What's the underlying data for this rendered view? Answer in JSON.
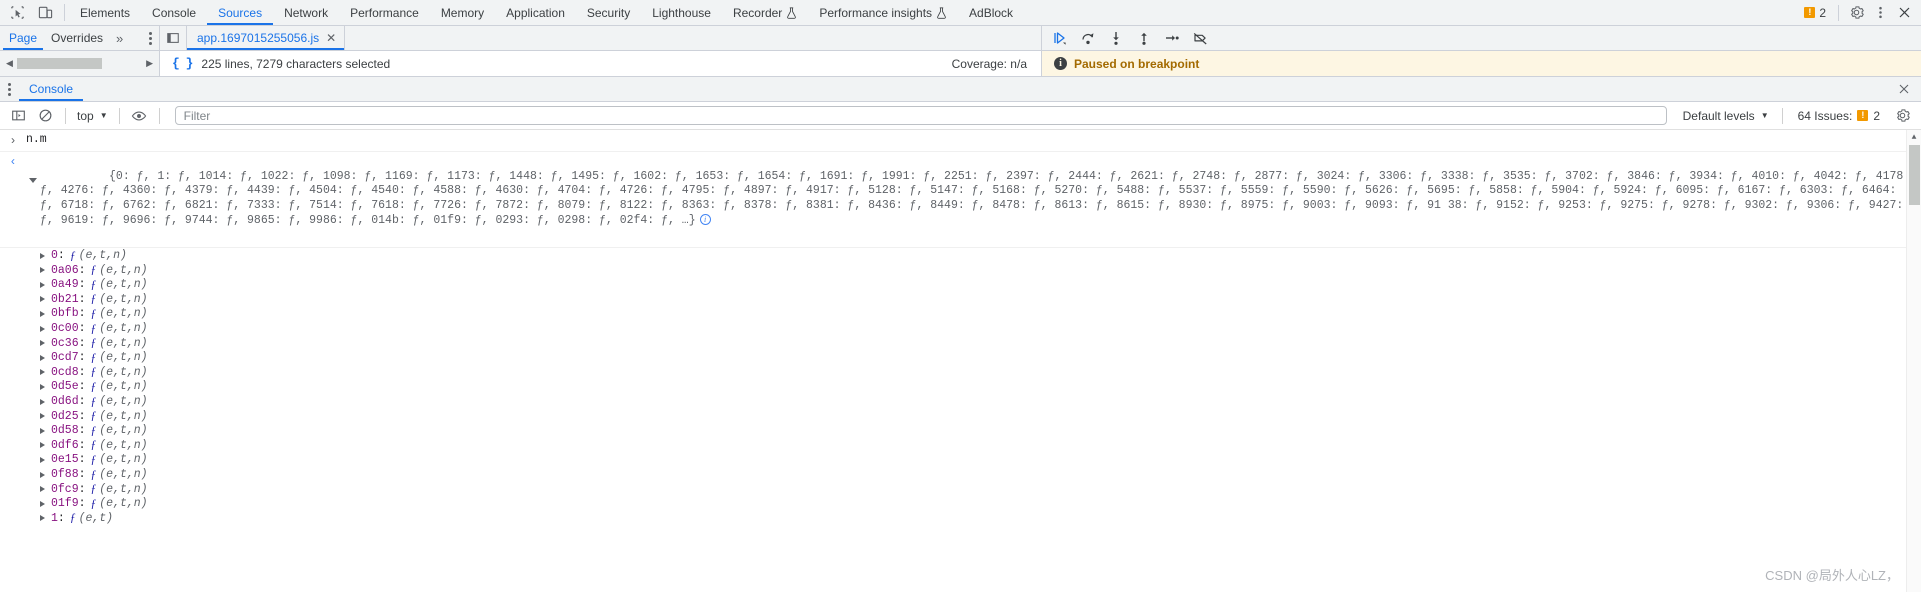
{
  "toolbar": {
    "inspect_icon": "inspect-element-icon",
    "device_icon": "device-toolbar-icon",
    "tabs": [
      {
        "label": "Elements",
        "active": false,
        "experimental": false
      },
      {
        "label": "Console",
        "active": false,
        "experimental": false
      },
      {
        "label": "Sources",
        "active": true,
        "experimental": false
      },
      {
        "label": "Network",
        "active": false,
        "experimental": false
      },
      {
        "label": "Performance",
        "active": false,
        "experimental": false
      },
      {
        "label": "Memory",
        "active": false,
        "experimental": false
      },
      {
        "label": "Application",
        "active": false,
        "experimental": false
      },
      {
        "label": "Security",
        "active": false,
        "experimental": false
      },
      {
        "label": "Lighthouse",
        "active": false,
        "experimental": false
      },
      {
        "label": "Recorder",
        "active": false,
        "experimental": true
      },
      {
        "label": "Performance insights",
        "active": false,
        "experimental": true
      },
      {
        "label": "AdBlock",
        "active": false,
        "experimental": false
      }
    ],
    "issues_count": "2",
    "warning_glyph": "!",
    "settings_icon": "gear-icon",
    "more_icon": "kebab-menu-icon",
    "close_icon": "close-icon"
  },
  "sources": {
    "nav_tabs": [
      {
        "label": "Page",
        "active": true
      },
      {
        "label": "Overrides",
        "active": false
      }
    ],
    "more_tabs_glyph": "»",
    "nav_kebab": "kebab-menu-icon",
    "file_tab": {
      "label": "app.1697015255056.js",
      "close_glyph": "✕"
    },
    "status": {
      "pretty_print_glyph": "{ }",
      "selection_text": "225 lines, 7279 characters selected",
      "coverage_text": "Coverage: n/a"
    },
    "panel_icon": "show-navigator-icon"
  },
  "debugger": {
    "buttons": [
      {
        "name": "resume-script-execution",
        "title": "Resume"
      },
      {
        "name": "step-over-next-function-call",
        "title": "Step over"
      },
      {
        "name": "step-into-next-function-call",
        "title": "Step into"
      },
      {
        "name": "step-out-of-current-function",
        "title": "Step out"
      },
      {
        "name": "step",
        "title": "Step"
      },
      {
        "name": "deactivate-breakpoints",
        "title": "Deactivate breakpoints"
      }
    ],
    "paused_banner": {
      "icon": "info-icon",
      "text": "Paused on breakpoint"
    }
  },
  "drawer": {
    "kebab": "kebab-menu-icon",
    "tabs": [
      {
        "label": "Console",
        "active": true
      }
    ],
    "close_icon": "close-icon"
  },
  "console_toolbar": {
    "sidebar_icon": "console-sidebar-icon",
    "clear_icon": "clear-console-icon",
    "context_label": "top",
    "context_caret": "▼",
    "eye_icon": "live-expression-icon",
    "filter_placeholder": "Filter",
    "filter_value": "",
    "levels_label": "Default levels",
    "levels_caret": "▼",
    "issues_label": "64 Issues:",
    "issues_count": "2",
    "issues_glyph": "!",
    "settings_icon": "gear-icon"
  },
  "console": {
    "input_prompt": "›",
    "input_expression": "n.m",
    "result_prompt": "‹",
    "object_preview_lines": [
      "{0: ƒ, 1: ƒ, 1014: ƒ, 1022: ƒ, 1098: ƒ, 1169: ƒ, 1173: ƒ, 1448: ƒ, 1495: ƒ, 1602: ƒ, 1653: ƒ, 1654: ƒ, 1691: ƒ, 1991: ƒ, 2251: ƒ, 2397: ƒ, 2444: ƒ, 2621: ƒ, 2748: ƒ, 2877: ƒ, 3024: ƒ, 3306: ƒ, 3338: ƒ, 3535: ƒ, 3702: ƒ, 3846: ƒ, 3934: ƒ, 4010:",
      "ƒ, 4042: ƒ, 4178: ƒ, 4276: ƒ, 4360: ƒ, 4379: ƒ, 4439: ƒ, 4504: ƒ, 4540: ƒ, 4588: ƒ, 4630: ƒ, 4704: ƒ, 4726: ƒ, 4795: ƒ, 4897: ƒ, 4917: ƒ, 5128: ƒ, 5147: ƒ, 5168: ƒ, 5270: ƒ, 5488: ƒ, 5537: ƒ, 5559: ƒ, 5590: ƒ, 5626: ƒ, 5695: ƒ, 5858: ƒ, 5904: ƒ,",
      "5924: ƒ, 6095: ƒ, 6167: ƒ, 6303: ƒ, 6464: ƒ, 6718: ƒ, 6762: ƒ, 6821: ƒ, 7333: ƒ, 7514: ƒ, 7618: ƒ, 7726: ƒ, 7872: ƒ, 8079: ƒ, 8122: ƒ, 8363: ƒ, 8378: ƒ, 8381: ƒ, 8436: ƒ, 8449: ƒ, 8478: ƒ, 8613: ƒ, 8615: ƒ, 8930: ƒ, 8975: ƒ, 9003: ƒ, 9093: ƒ, 91",
      "38: ƒ, 9152: ƒ, 9253: ƒ, 9275: ƒ, 9278: ƒ, 9302: ƒ, 9306: ƒ, 9427: ƒ, 9619: ƒ, 9696: ƒ, 9744: ƒ, 9865: ƒ, 9986: ƒ, 014b: ƒ, 01f9: ƒ, 0293: ƒ, 0298: ƒ, 02f4: ƒ, …}"
    ],
    "properties": [
      {
        "key": "0",
        "fn": "ƒ",
        "args": "(e,t,n)"
      },
      {
        "key": "0a06",
        "fn": "ƒ",
        "args": "(e,t,n)"
      },
      {
        "key": "0a49",
        "fn": "ƒ",
        "args": "(e,t,n)"
      },
      {
        "key": "0b21",
        "fn": "ƒ",
        "args": "(e,t,n)"
      },
      {
        "key": "0bfb",
        "fn": "ƒ",
        "args": "(e,t,n)"
      },
      {
        "key": "0c00",
        "fn": "ƒ",
        "args": "(e,t,n)"
      },
      {
        "key": "0c36",
        "fn": "ƒ",
        "args": "(e,t,n)"
      },
      {
        "key": "0cd7",
        "fn": "ƒ",
        "args": "(e,t,n)"
      },
      {
        "key": "0cd8",
        "fn": "ƒ",
        "args": "(e,t,n)"
      },
      {
        "key": "0d5e",
        "fn": "ƒ",
        "args": "(e,t,n)"
      },
      {
        "key": "0d6d",
        "fn": "ƒ",
        "args": "(e,t,n)"
      },
      {
        "key": "0d25",
        "fn": "ƒ",
        "args": "(e,t,n)"
      },
      {
        "key": "0d58",
        "fn": "ƒ",
        "args": "(e,t,n)"
      },
      {
        "key": "0df6",
        "fn": "ƒ",
        "args": "(e,t,n)"
      },
      {
        "key": "0e15",
        "fn": "ƒ",
        "args": "(e,t,n)"
      },
      {
        "key": "0f88",
        "fn": "ƒ",
        "args": "(e,t,n)"
      },
      {
        "key": "0fc9",
        "fn": "ƒ",
        "args": "(e,t,n)"
      },
      {
        "key": "01f9",
        "fn": "ƒ",
        "args": "(e,t,n)"
      },
      {
        "key": "1",
        "fn": "ƒ",
        "args": "(e,t)"
      }
    ]
  },
  "watermark": "CSDN @局外人心LZ，"
}
